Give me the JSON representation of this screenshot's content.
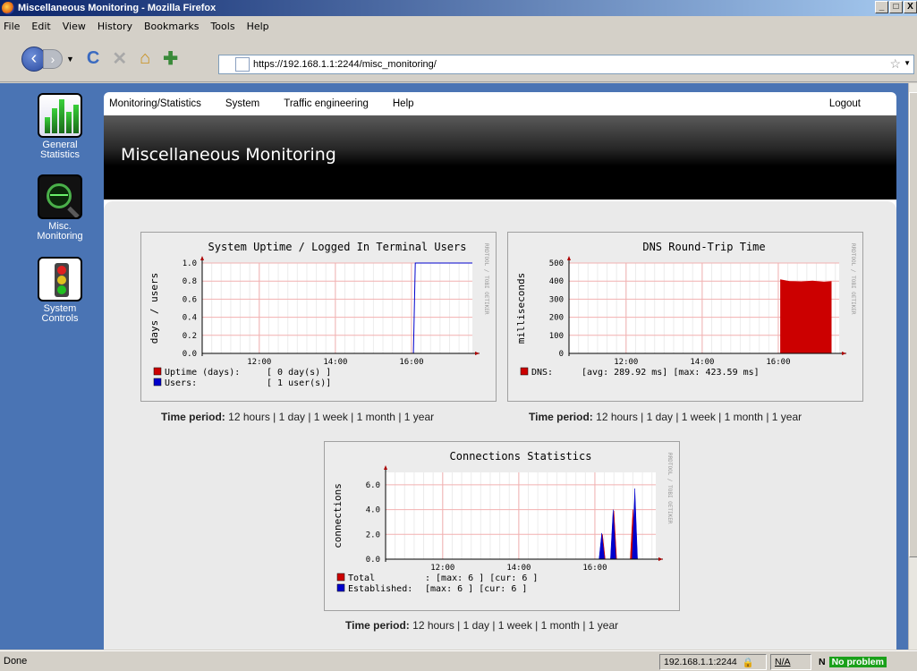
{
  "window": {
    "title": "Miscellaneous Monitoring - Mozilla Firefox",
    "controls": [
      "_",
      "□",
      "X"
    ]
  },
  "menubar": [
    "File",
    "Edit",
    "View",
    "History",
    "Bookmarks",
    "Tools",
    "Help"
  ],
  "url": "https://192.168.1.1:2244/misc_monitoring/",
  "sidebar": [
    {
      "label1": "General",
      "label2": "Statistics",
      "icon": "bar-chart-icon"
    },
    {
      "label1": "Misc.",
      "label2": "Monitoring",
      "icon": "magnifier-icon"
    },
    {
      "label1": "System",
      "label2": "Controls",
      "icon": "traffic-light-icon"
    }
  ],
  "topnav": [
    "Monitoring/Statistics",
    "System",
    "Traffic engineering",
    "Help"
  ],
  "logout": "Logout",
  "page_title": "Miscellaneous Monitoring",
  "time_period": {
    "label": "Time period:",
    "options": [
      "12 hours",
      "1 day",
      "1 week",
      "1 month",
      "1 year"
    ],
    "sep": "|"
  },
  "watermark": "RRDTOOL / TOBI OETIKER",
  "chart_data": [
    {
      "type": "line",
      "title": "System Uptime / Logged In Terminal Users",
      "ylabel": "days / users",
      "ylim": [
        0,
        1.0
      ],
      "yticks": [
        "1.0",
        "0.8",
        "0.6",
        "0.4",
        "0.2",
        "0.0"
      ],
      "xticks": [
        "12:00",
        "14:00",
        "16:00"
      ],
      "xrange_hours": [
        10.5,
        17.6
      ],
      "series": [
        {
          "name": "Uptime (days):",
          "color": "#cc0000",
          "legend_text": "[    0 day(s) ]",
          "points": [
            [
              10.5,
              0
            ],
            [
              17.6,
              0
            ]
          ]
        },
        {
          "name": "Users:",
          "color": "#0000cc",
          "legend_text": "[    1 user(s)]",
          "points": [
            [
              10.5,
              0
            ],
            [
              16.05,
              0
            ],
            [
              16.1,
              1.0
            ],
            [
              17.6,
              1.0
            ]
          ]
        }
      ]
    },
    {
      "type": "area",
      "title": "DNS Round-Trip Time",
      "ylabel": "milliseconds",
      "ylim": [
        0,
        500
      ],
      "yticks": [
        "500",
        "400",
        "300",
        "200",
        "100",
        "0"
      ],
      "xticks": [
        "12:00",
        "14:00",
        "16:00"
      ],
      "xrange_hours": [
        10.5,
        17.6
      ],
      "series": [
        {
          "name": "DNS:",
          "color": "#cc0000",
          "legend_text": "[avg:  289.92  ms]    [max:  423.59  ms]",
          "points": [
            [
              16.05,
              410
            ],
            [
              16.3,
              400
            ],
            [
              16.6,
              398
            ],
            [
              16.9,
              402
            ],
            [
              17.2,
              396
            ],
            [
              17.4,
              400
            ]
          ]
        }
      ]
    },
    {
      "type": "area",
      "title": "Connections Statistics",
      "ylabel": "connections",
      "ylim": [
        0,
        7
      ],
      "yticks": [
        "6.0",
        "4.0",
        "2.0",
        "0.0"
      ],
      "xticks": [
        "12:00",
        "14:00",
        "16:00"
      ],
      "xrange_hours": [
        10.5,
        17.6
      ],
      "series": [
        {
          "name": "Total",
          "color": "#cc0000",
          "legend_text": ":     [max:     6  ]    [cur:     6  ]",
          "spikes": [
            [
              16.2,
              2.0
            ],
            [
              16.5,
              3.9
            ],
            [
              17.0,
              4.0
            ]
          ]
        },
        {
          "name": "Established:",
          "color": "#0000cc",
          "legend_text": "[max:     6  ]    [cur:     6  ]",
          "spikes": [
            [
              16.18,
              2.1
            ],
            [
              16.48,
              4.0
            ],
            [
              17.05,
              5.7
            ]
          ]
        }
      ]
    }
  ],
  "status": {
    "left": "Done",
    "host": "192.168.1.1:2244",
    "na": "N/A",
    "noscript": "No problem"
  }
}
